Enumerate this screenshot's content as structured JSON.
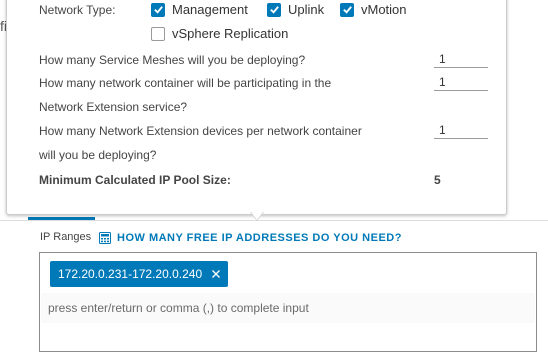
{
  "background": {
    "stub_text": "fi"
  },
  "popover": {
    "network_type_label": "Network Type:",
    "network_types": [
      {
        "label": "Management",
        "checked": true
      },
      {
        "label": "Uplink",
        "checked": true
      },
      {
        "label": "vMotion",
        "checked": true
      },
      {
        "label": "vSphere Replication",
        "checked": false
      }
    ],
    "q_service_meshes": "How many Service Meshes will you be deploying?",
    "q_service_meshes_value": "1",
    "q_containers_line1": "How many network container will be participating in the",
    "q_containers_line2": "Network Extension service?",
    "q_containers_value": "1",
    "q_devices_line1": "How many Network Extension devices per network container",
    "q_devices_line2": "will you be deploying?",
    "q_devices_value": "1",
    "min_pool_label": "Minimum Calculated IP Pool Size:",
    "min_pool_value": "5"
  },
  "ip_ranges": {
    "label": "IP Ranges",
    "calc_icon": "calculator-icon",
    "link_text": "HOW MANY FREE IP ADDRESSES DO YOU NEED?",
    "chips": [
      "172.20.0.231-172.20.0.240"
    ],
    "input_placeholder": "press enter/return or comma (,) to complete input",
    "input_value": ""
  },
  "colors": {
    "accent": "#0079b8",
    "text": "#454545",
    "border": "#8c8c8c"
  }
}
